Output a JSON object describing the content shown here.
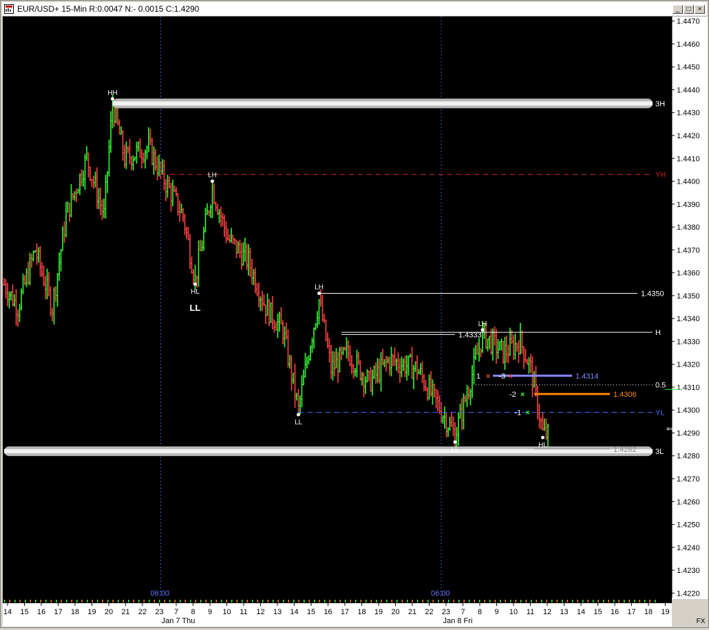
{
  "window": {
    "title": "EUR/USD+ 15-Min R:0.0047 N:- 0.0015 C:1.4290",
    "min_label": "_",
    "max_label": "□",
    "close_label": "×"
  },
  "chart_data": {
    "type": "bar",
    "style": "ohlc",
    "symbol": "EUR/USD+",
    "interval": "15-Min",
    "ylim": [
      1.4218,
      1.4472
    ],
    "y_ticks": [
      "1.4470",
      "1.4460",
      "1.4450",
      "1.4440",
      "1.4430",
      "1.4420",
      "1.4410",
      "1.4400",
      "1.4390",
      "1.4380",
      "1.4370",
      "1.4360",
      "1.4350",
      "1.4340",
      "1.4330",
      "1.4320",
      "1.4310",
      "1.4300",
      "1.4290",
      "1.4280",
      "1.4270",
      "1.4260",
      "1.4250",
      "1.4240",
      "1.4230",
      "1.4220"
    ],
    "x_hour_labels": [
      "14",
      "15",
      "16",
      "17",
      "18",
      "19",
      "20",
      "21",
      "22",
      "23",
      "7",
      "8",
      "9",
      "10",
      "11",
      "12",
      "13",
      "14",
      "15",
      "16",
      "17",
      "18",
      "19",
      "20",
      "21",
      "22",
      "23",
      "7",
      "8",
      "9",
      "10",
      "11",
      "12",
      "13",
      "14",
      "15",
      "16",
      "17",
      "18",
      "19"
    ],
    "x_day_labels": [
      "Jan 7 Thu",
      "Jan 8 Fri"
    ],
    "session_labels": [
      "06:00",
      "06:00"
    ],
    "corner_label": "FX",
    "up_color": "#33ff33",
    "down_color": "#ff4444",
    "background": "#000000",
    "grid": false,
    "key_levels": [
      {
        "label": "3H",
        "value": 1.4434,
        "style": "band"
      },
      {
        "label": "3L",
        "value": 1.4282,
        "style": "band"
      },
      {
        "label": "YH",
        "value": 1.4403,
        "style": "dashed",
        "color": "#cc2222"
      },
      {
        "label": "YL",
        "value": 1.4299,
        "style": "dashed",
        "color": "#4466ff"
      },
      {
        "label": "H",
        "value": 1.4334,
        "style": "solid",
        "color": "#ffffff"
      },
      {
        "label": "0.5",
        "value": 1.4311,
        "style": "dotted",
        "color": "#ffffff"
      }
    ],
    "swing_labels": [
      {
        "label": "HH",
        "bar": 63,
        "value": 1.4436,
        "pos": "above"
      },
      {
        "label": "LH",
        "bar": 121,
        "value": 1.44,
        "pos": "above"
      },
      {
        "label": "HL",
        "bar": 111,
        "value": 1.4355,
        "pos": "below"
      },
      {
        "label": "LL",
        "bar": 111,
        "value": 1.435,
        "pos": "below-big"
      },
      {
        "label": "LH",
        "bar": 183,
        "value": 1.4351,
        "pos": "above"
      },
      {
        "label": "LL",
        "bar": 171,
        "value": 1.4298,
        "pos": "below"
      },
      {
        "label": "LH",
        "bar": 278,
        "value": 1.4335,
        "pos": "above"
      },
      {
        "label": "LL",
        "bar": 262,
        "value": 1.4286,
        "pos": "below"
      },
      {
        "label": "HL",
        "bar": 313,
        "value": 1.4288,
        "pos": "below"
      }
    ],
    "price_labels": [
      {
        "label": "1.4350",
        "value": 1.4351,
        "color": "#ffffff"
      },
      {
        "label": "1.4333",
        "value": 1.4333,
        "color": "#ffffff"
      },
      {
        "label": "1.4314",
        "value": 1.4315,
        "color": "#8888ff"
      },
      {
        "label": "1.4306",
        "value": 1.4307,
        "color": "#ff8800"
      },
      {
        "label": "1.4282",
        "value": 1.4283,
        "color": "#888888"
      }
    ],
    "trade_marks": [
      "1",
      "-3",
      "-2",
      "-1"
    ]
  }
}
